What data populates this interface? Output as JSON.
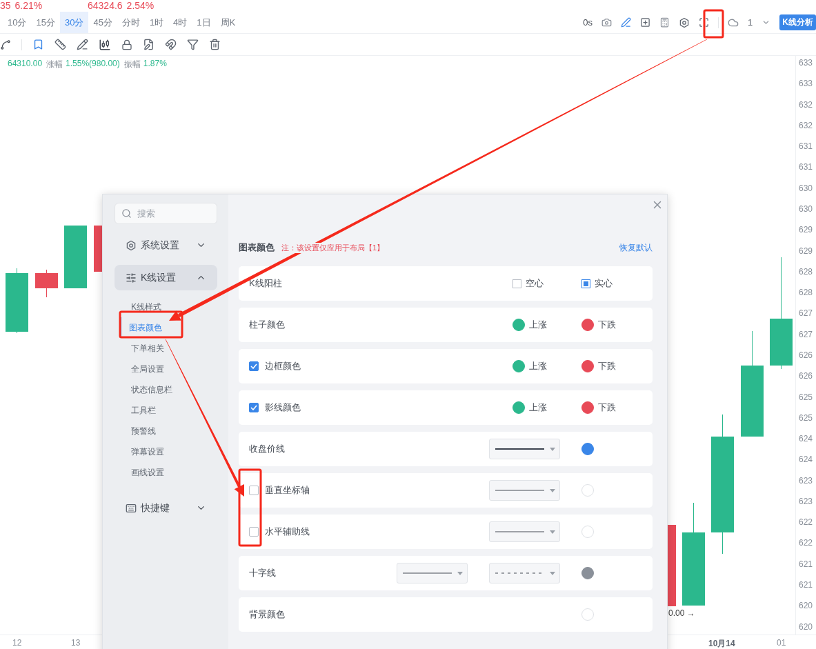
{
  "tickers": [
    {
      "price": "35",
      "change": "6.21%"
    },
    {
      "price": "64324.6",
      "change": "2.54%"
    }
  ],
  "periods": [
    {
      "label": "10分",
      "selected": false
    },
    {
      "label": "15分",
      "selected": false
    },
    {
      "label": "30分",
      "selected": true
    },
    {
      "label": "45分",
      "selected": false
    },
    {
      "label": "分时",
      "selected": false
    },
    {
      "label": "1时",
      "selected": false
    },
    {
      "label": "4时",
      "selected": false
    },
    {
      "label": "1日",
      "selected": false
    },
    {
      "label": "周K",
      "selected": false
    }
  ],
  "toolbar": {
    "timer": "0s",
    "cloud_count": "1",
    "analysis_button": "K线分析"
  },
  "stats": [
    {
      "value": "64310.00"
    },
    {
      "label": "涨幅",
      "value": "1.55%(980.00)"
    },
    {
      "label": "振幅",
      "value": "1.87%"
    }
  ],
  "price_axis": [
    "633",
    "633",
    "632",
    "632",
    "631",
    "631",
    "630",
    "630",
    "629",
    "629",
    "628",
    "628",
    "627",
    "627",
    "626",
    "626",
    "625",
    "625",
    "624",
    "624",
    "623",
    "623",
    "622",
    "622",
    "621",
    "621",
    "620",
    "620"
  ],
  "time_axis": [
    {
      "label": "12",
      "emphasis": false
    },
    {
      "label": "13",
      "emphasis": false
    },
    {
      "label": "10月14",
      "emphasis": true
    },
    {
      "label": "01",
      "emphasis": false
    }
  ],
  "chart_note": "0.00 →",
  "dialog": {
    "search": {
      "placeholder": "搜索"
    },
    "menu": [
      {
        "label": "系统设置",
        "kind": "gear",
        "expanded": false
      },
      {
        "label": "K线设置",
        "kind": "sliders",
        "expanded": true,
        "children": [
          {
            "label": "K线样式",
            "selected": false
          },
          {
            "label": "图表颜色",
            "selected": true
          },
          {
            "label": "下单相关",
            "selected": false
          },
          {
            "label": "全局设置",
            "selected": false
          },
          {
            "label": "状态信息栏",
            "selected": false
          },
          {
            "label": "工具栏",
            "selected": false
          },
          {
            "label": "预警线",
            "selected": false
          },
          {
            "label": "弹幕设置",
            "selected": false
          },
          {
            "label": "画线设置",
            "selected": false
          }
        ]
      },
      {
        "label": "快捷键",
        "kind": "keyboard",
        "expanded": false
      }
    ],
    "title": "图表颜色",
    "note": "注：该设置仅应用于布局【1】",
    "reset": "恢复默认",
    "rows": [
      {
        "kind": "radio",
        "label": "K线阳柱",
        "options": [
          {
            "label": "空心",
            "selected": false
          },
          {
            "label": "实心",
            "selected": true
          }
        ]
      },
      {
        "kind": "colors",
        "label": "柱子颜色",
        "options": [
          {
            "label": "上涨",
            "color": "#2bb88d"
          },
          {
            "label": "下跌",
            "color": "#e84a57"
          }
        ]
      },
      {
        "kind": "colors",
        "label": "边框颜色",
        "checked": true,
        "options": [
          {
            "label": "上涨",
            "color": "#2bb88d"
          },
          {
            "label": "下跌",
            "color": "#e84a57"
          }
        ]
      },
      {
        "kind": "colors",
        "label": "影线颜色",
        "checked": true,
        "options": [
          {
            "label": "上涨",
            "color": "#2bb88d"
          },
          {
            "label": "下跌",
            "color": "#e84a57"
          }
        ]
      },
      {
        "kind": "line",
        "label": "收盘价线",
        "lines": [
          {
            "kind": "solid",
            "bold": true
          }
        ],
        "color": "#3a86e8"
      },
      {
        "kind": "line",
        "label": "垂直坐标轴",
        "checked": false,
        "lines": [
          {
            "kind": "solid",
            "bold": false
          }
        ],
        "color": "#ffffff"
      },
      {
        "kind": "line",
        "label": "水平辅助线",
        "checked": false,
        "lines": [
          {
            "kind": "solid",
            "bold": false
          }
        ],
        "color": "#ffffff"
      },
      {
        "kind": "line",
        "label": "十字线",
        "lines": [
          {
            "kind": "solid",
            "bold": false
          },
          {
            "kind": "dashed",
            "bold": false
          }
        ],
        "color": "#8a9099"
      },
      {
        "kind": "line",
        "label": "背景颜色",
        "color": "#ffffff"
      }
    ]
  }
}
